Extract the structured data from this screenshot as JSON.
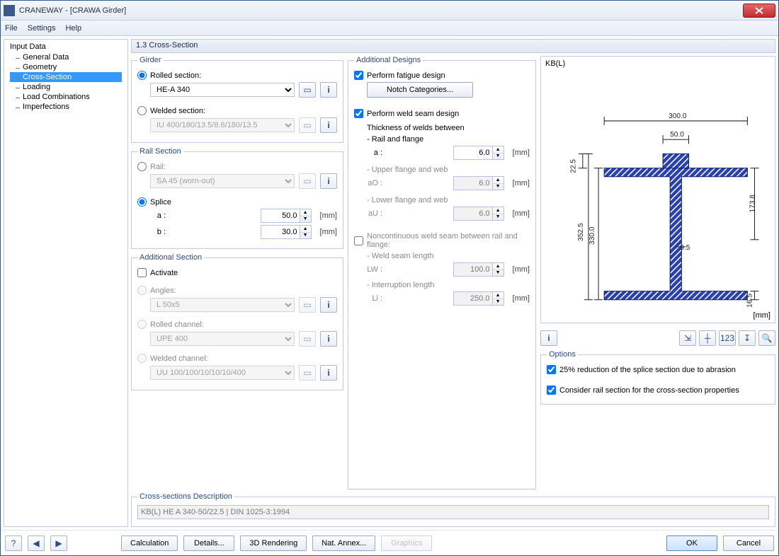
{
  "window": {
    "title": "CRANEWAY - [CRAWA Girder]"
  },
  "menu": {
    "file": "File",
    "settings": "Settings",
    "help": "Help"
  },
  "tree": {
    "root": "Input Data",
    "items": [
      "General Data",
      "Geometry",
      "Cross-Section",
      "Loading",
      "Load Combinations",
      "Imperfections"
    ],
    "selected": 2
  },
  "page": {
    "title": "1.3 Cross-Section"
  },
  "girder": {
    "legend": "Girder",
    "rolled_label": "Rolled section:",
    "rolled_value": "HE-A 340",
    "welded_label": "Welded section:",
    "welded_value": "IU 400/180/13.5/8.6/180/13.5"
  },
  "rail": {
    "legend": "Rail Section",
    "rail_label": "Rail:",
    "rail_value": "SA 45 (worn-out)",
    "splice_label": "Splice",
    "a_label": "a :",
    "a_value": "50.0",
    "b_label": "b :",
    "b_value": "30.0",
    "unit": "[mm]"
  },
  "addsec": {
    "legend": "Additional Section",
    "activate_label": "Activate",
    "angles_label": "Angles:",
    "angles_value": "L 50x5",
    "rolledch_label": "Rolled channel:",
    "rolledch_value": "UPE 400",
    "weldedch_label": "Welded channel:",
    "weldedch_value": "UU 100/100/10/10/10/400"
  },
  "designs": {
    "legend": "Additional Designs",
    "fatigue_label": "Perform fatigue design",
    "notch_btn": "Notch Categories...",
    "weldseam_label": "Perform weld seam design",
    "thick_label": "Thickness of welds between",
    "railflange": "- Rail and flange",
    "a": "a :",
    "a_val": "6.0",
    "upper": "- Upper flange and web",
    "ao": "aO :",
    "ao_val": "6.0",
    "lower": "- Lower flange and web",
    "au": "aU :",
    "au_val": "6.0",
    "nonc_label": "Noncontinuous weld seam between rail and flange:",
    "ws_len": "- Weld seam length",
    "lw": "LW :",
    "lw_val": "100.0",
    "int_len": "- Interruption length",
    "li": "Li :",
    "li_val": "250.0",
    "unit": "[mm]"
  },
  "desc": {
    "legend": "Cross-sections Description",
    "value": "KB(L) HE A 340-50/22.5 | DIN 1025-3:1994"
  },
  "preview": {
    "label": "KB(L)",
    "unit": "[mm]",
    "dims": {
      "w_top": "300.0",
      "w_rail": "50.0",
      "h_rail": "22.5",
      "h_tot": "352.5",
      "h_in": "330.0",
      "t_web": "9.5",
      "h_flg": "173.8",
      "t_flg": "16.5"
    }
  },
  "options": {
    "legend": "Options",
    "opt1": "25% reduction of the splice section due to abrasion",
    "opt2": "Consider rail section for the cross-section properties"
  },
  "footer": {
    "calc": "Calculation",
    "details": "Details...",
    "render": "3D Rendering",
    "nat": "Nat. Annex...",
    "gfx": "Graphics",
    "ok": "OK",
    "cancel": "Cancel"
  }
}
